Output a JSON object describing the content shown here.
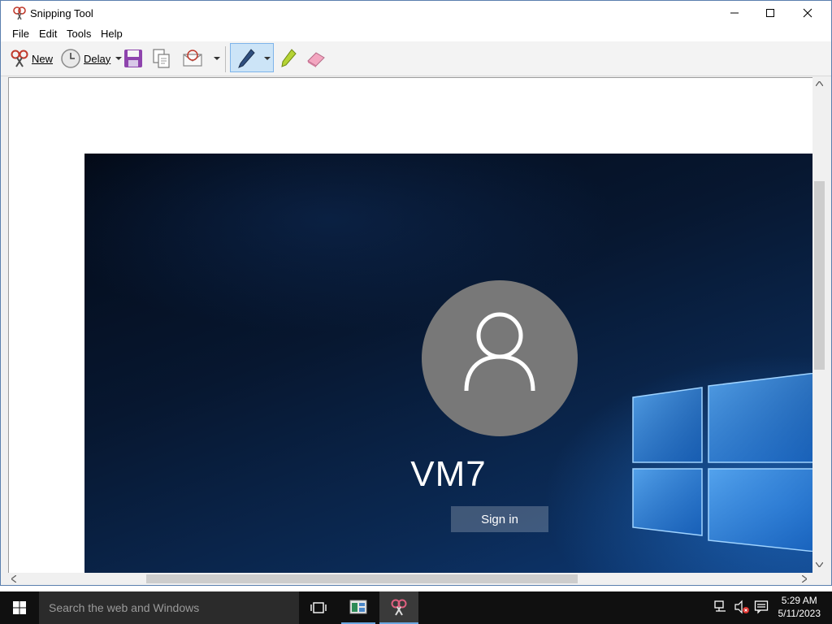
{
  "window": {
    "title": "Snipping Tool",
    "controls": {
      "minimize": "minimize",
      "maximize": "maximize",
      "close": "close"
    }
  },
  "menu": {
    "items": [
      "File",
      "Edit",
      "Tools",
      "Help"
    ]
  },
  "toolbar": {
    "new_label": "New",
    "delay_label": "Delay",
    "icons": [
      "scissors-icon",
      "clock-icon",
      "save-icon",
      "copy-icon",
      "send-email-icon",
      "pen-icon",
      "highlighter-icon",
      "eraser-icon"
    ]
  },
  "screenshot": {
    "username": "VM7",
    "signin_label": "Sign in"
  },
  "taskbar": {
    "search_placeholder": "Search the web and Windows",
    "time": "5:29 AM",
    "date": "5/11/2023"
  },
  "colors": {
    "accent": "#0078d7",
    "pen_selected_bg": "#cce4f7",
    "avatar_gray": "#787878",
    "lock_bg": "#071730"
  }
}
